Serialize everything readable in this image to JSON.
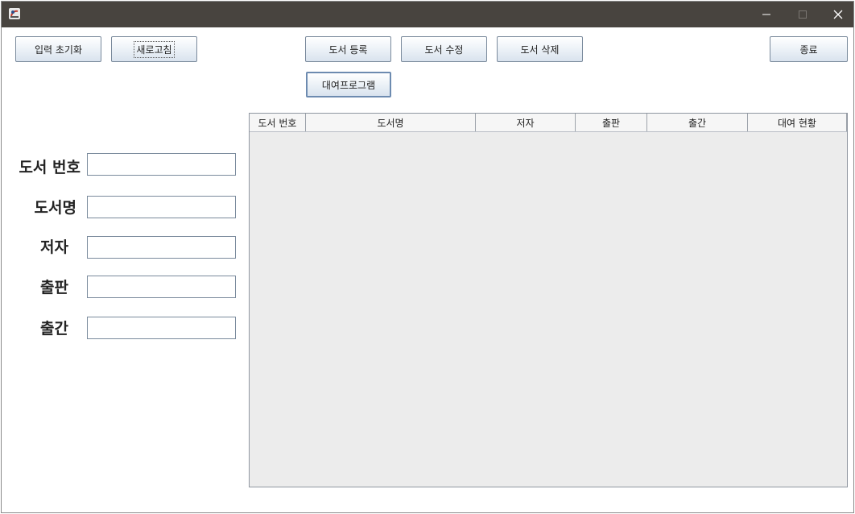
{
  "window": {
    "controls": {
      "minimize": "–",
      "maximize": "□",
      "close": "✕"
    },
    "icon": "java-app-icon"
  },
  "toolbar": {
    "reset_input": "입력 초기화",
    "refresh": "새로고침",
    "register_book": "도서 등록",
    "edit_book": "도서 수정",
    "delete_book": "도서 삭제",
    "exit": "종료",
    "rental_program": "대여프로그램"
  },
  "form": {
    "book_number_label": "도서 번호",
    "title_label": "도서명",
    "author_label": "저자",
    "publisher_label": "출판",
    "published_label": "출간",
    "book_number_value": "",
    "title_value": "",
    "author_value": "",
    "publisher_value": "",
    "published_value": ""
  },
  "table": {
    "columns": [
      "도서 번호",
      "도서명",
      "저자",
      "출판",
      "출간",
      "대여 현황"
    ],
    "rows": []
  },
  "colors": {
    "titlebar": "#48443f",
    "table_background": "#ececec",
    "button_border": "#7a8a9c"
  }
}
